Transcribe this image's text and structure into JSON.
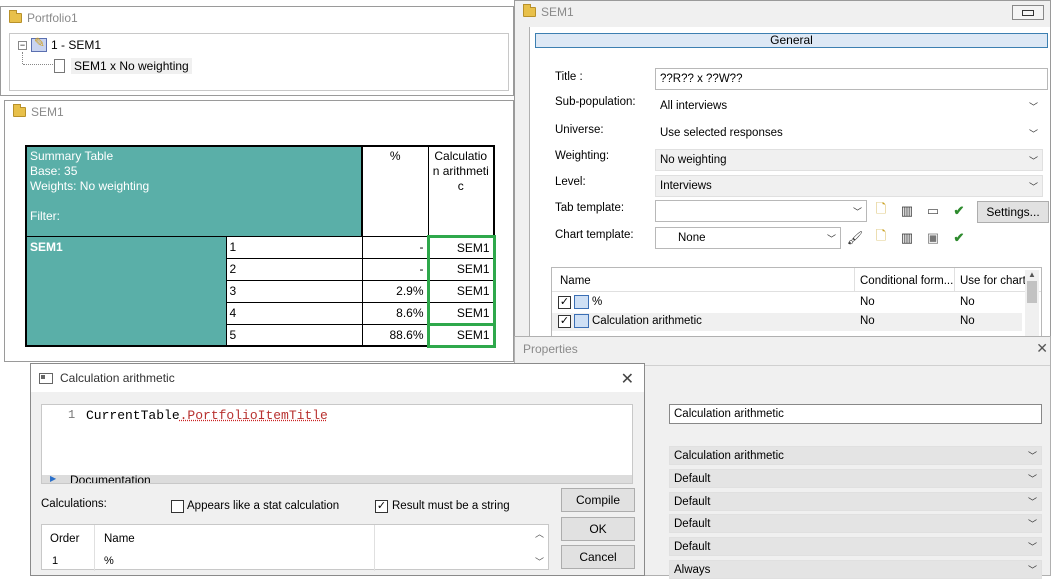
{
  "portfolio": {
    "title": "Portfolio1",
    "tree_root": "1 - SEM1",
    "tree_child": "SEM1 x No weighting"
  },
  "sem_table_window": {
    "title": "SEM1",
    "header_lines": [
      "Summary Table",
      "Base: 35",
      "Weights: No weighting",
      "",
      "Filter:"
    ],
    "col_percent": "%",
    "col_calc": "Calculation arithmetic",
    "row_group": "SEM1",
    "rows": [
      {
        "label": "1",
        "pct": "-",
        "calc": "SEM1"
      },
      {
        "label": "2",
        "pct": "-",
        "calc": "SEM1"
      },
      {
        "label": "3",
        "pct": "2.9%",
        "calc": "SEM1"
      },
      {
        "label": "4",
        "pct": "8.6%",
        "calc": "SEM1"
      },
      {
        "label": "5",
        "pct": "88.6%",
        "calc": "SEM1"
      }
    ]
  },
  "sem_right": {
    "title": "SEM1",
    "tab_general": "General",
    "title_label": "Title :",
    "title_value": "??R?? x ??W??",
    "subpop_label": "Sub-population:",
    "subpop_value": "All interviews",
    "universe_label": "Universe:",
    "universe_value": "Use selected responses",
    "weighting_label": "Weighting:",
    "weighting_value": "No weighting",
    "level_label": "Level:",
    "level_value": "Interviews",
    "tab_template_label": "Tab template:",
    "tab_template_value": "",
    "settings_button": "Settings...",
    "chart_template_label": "Chart template:",
    "chart_template_value": "None",
    "grid_headers": [
      "Name",
      "Conditional form...",
      "Use for chart"
    ],
    "grid_rows": [
      {
        "name": "%",
        "cond": "No",
        "chart": "No"
      },
      {
        "name": "Calculation arithmetic",
        "cond": "No",
        "chart": "No"
      }
    ]
  },
  "properties": {
    "title": "Properties",
    "name_value": "Calculation arithmetic",
    "dropdowns": [
      "Calculation arithmetic",
      "Default",
      "Default",
      "Default",
      "Default",
      "Always"
    ]
  },
  "calc_dialog": {
    "title": "Calculation arithmetic",
    "line_number": "1",
    "code_obj": "CurrentTable",
    "code_member": ".PortfolioItemTitle",
    "documentation": "Documentation",
    "calculations_label": "Calculations:",
    "cb_stat_label": "Appears like a stat calculation",
    "cb_string_label": "Result must be a string",
    "compile_button": "Compile",
    "ok_button": "OK",
    "cancel_button": "Cancel",
    "list_headers": [
      "Order",
      "Name"
    ],
    "list_rows": [
      {
        "order": "1",
        "name": "%"
      }
    ]
  }
}
